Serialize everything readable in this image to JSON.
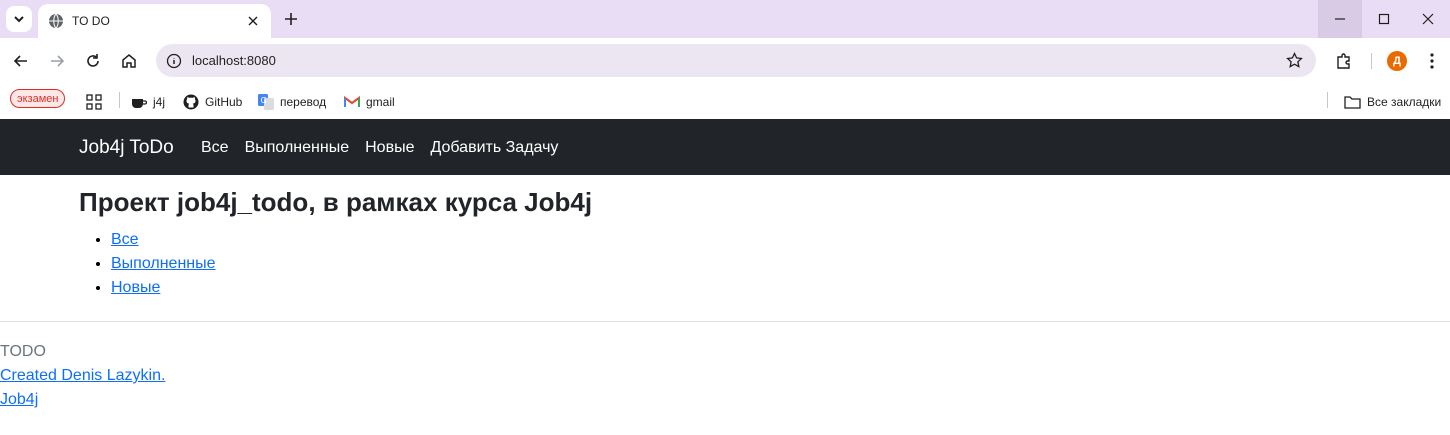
{
  "browser": {
    "tab_title": "TO DO",
    "url": "localhost:8080",
    "profile_initial": "Д",
    "bookmarks": [
      {
        "label": "экзамен"
      },
      {
        "label": "j4j"
      },
      {
        "label": "GitHub"
      },
      {
        "label": "перевод"
      },
      {
        "label": "gmail"
      }
    ],
    "all_bookmarks": "Все закладки"
  },
  "navbar": {
    "brand": "Job4j ToDo",
    "links": [
      "Все",
      "Выполненные",
      "Новые",
      "Добавить Задачу"
    ]
  },
  "main": {
    "title": "Проект job4j_todo, в рамках курса Job4j",
    "links": [
      "Все",
      "Выполненные",
      "Новые"
    ]
  },
  "footer": {
    "name": "TODO",
    "created": "Created Denis Lazykin.",
    "link": "Job4j"
  },
  "colors": {
    "navbar_bg": "#212529",
    "link": "#0d6efd",
    "tabstrip": "#e9ddf5",
    "avatar": "#ea6a00"
  }
}
